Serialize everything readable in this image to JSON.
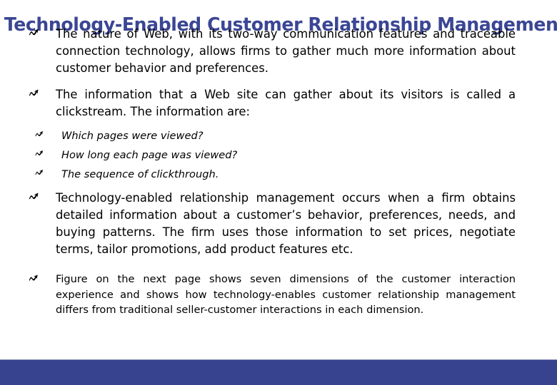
{
  "slide": {
    "title": "Technology-Enabled Customer Relationship Management",
    "title_color": "#3b4694",
    "footer_color": "#37438e",
    "background_color": "#ffffff",
    "text_color": "#000000",
    "bullet_icon": "squiggle-arrow-bullet",
    "bullets": [
      {
        "level": 1,
        "text": "The nature of Web, with its two-way communication features and traceable connection technology, allows firms to gather much more information about customer behavior and preferences."
      },
      {
        "level": 1,
        "text": "The information that a Web site can gather about its visitors is called a clickstream. The information are:"
      },
      {
        "level": 2,
        "text": "Which pages were viewed?"
      },
      {
        "level": 2,
        "text": "How long each page was viewed?"
      },
      {
        "level": 2,
        "text": "The sequence of clickthrough."
      },
      {
        "level": 1,
        "text": "Technology-enabled relationship management occurs when a firm obtains detailed information about a customer’s behavior, preferences, needs, and buying patterns. The firm uses those information to set prices, negotiate terms, tailor promotions, add product features etc."
      },
      {
        "level": 1,
        "small": true,
        "text": "Figure on the next page shows seven dimensions of the customer interaction experience and shows how technology-enables customer relationship management differs from traditional seller-customer interactions in each dimension."
      }
    ]
  }
}
